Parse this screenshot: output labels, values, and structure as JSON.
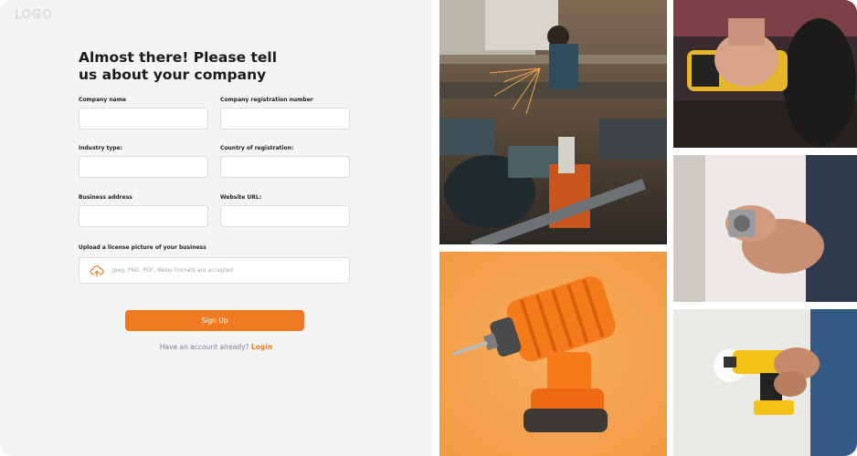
{
  "logo": "LOGO",
  "heading": "Almost there! Please tell us about your company",
  "fields": {
    "company_name": {
      "label": "Company name",
      "value": ""
    },
    "registration_number": {
      "label": "Company registration number",
      "value": ""
    },
    "industry_type": {
      "label": "Industry type:",
      "value": ""
    },
    "country": {
      "label": "Country of registration:",
      "value": ""
    },
    "address": {
      "label": "Business address",
      "value": ""
    },
    "website": {
      "label": "Website URL:",
      "value": ""
    }
  },
  "upload": {
    "label": "Upload a license picture of your business",
    "hint": "Jpeg, PNG, PDF, Webp formats are accepted",
    "icon": "cloud-upload-icon"
  },
  "signup": {
    "label": "Sign Up"
  },
  "account": {
    "prompt": "Have an account already?",
    "link": "Login"
  },
  "colors": {
    "accent": "#f07a21",
    "panel": "#f4f4f4",
    "text": "#1b1b1b",
    "muted": "#7a7f9a"
  }
}
